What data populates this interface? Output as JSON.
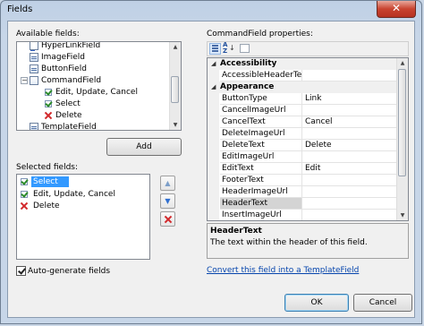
{
  "window": {
    "title": "Fields",
    "close_glyph": "✕"
  },
  "available": {
    "label": "Available fields:",
    "items": [
      {
        "label": "HyperLinkField",
        "icon": "hyperlink-field-icon"
      },
      {
        "label": "ImageField",
        "icon": "image-field-icon"
      },
      {
        "label": "ButtonField",
        "icon": "button-field-icon"
      },
      {
        "label": "CommandField",
        "icon": "command-field-icon",
        "expanded": true
      },
      {
        "label": "Edit, Update, Cancel",
        "icon": "check-icon"
      },
      {
        "label": "Select",
        "icon": "check-icon"
      },
      {
        "label": "Delete",
        "icon": "delete-icon"
      },
      {
        "label": "TemplateField",
        "icon": "template-field-icon"
      }
    ],
    "add_button": "Add"
  },
  "selected": {
    "label": "Selected fields:",
    "items": [
      {
        "label": "Select",
        "icon": "check-icon",
        "selected": true
      },
      {
        "label": "Edit, Update, Cancel",
        "icon": "check-icon"
      },
      {
        "label": "Delete",
        "icon": "delete-icon"
      }
    ]
  },
  "autogen": {
    "label": "Auto-generate fields",
    "checked": true
  },
  "properties": {
    "label": "CommandField properties:",
    "rows": [
      {
        "type": "category",
        "name": "Accessibility"
      },
      {
        "type": "prop",
        "name": "AccessibleHeaderText",
        "value": ""
      },
      {
        "type": "category",
        "name": "Appearance"
      },
      {
        "type": "prop",
        "name": "ButtonType",
        "value": "Link"
      },
      {
        "type": "prop",
        "name": "CancelImageUrl",
        "value": ""
      },
      {
        "type": "prop",
        "name": "CancelText",
        "value": "Cancel"
      },
      {
        "type": "prop",
        "name": "DeleteImageUrl",
        "value": ""
      },
      {
        "type": "prop",
        "name": "DeleteText",
        "value": "Delete"
      },
      {
        "type": "prop",
        "name": "EditImageUrl",
        "value": ""
      },
      {
        "type": "prop",
        "name": "EditText",
        "value": "Edit"
      },
      {
        "type": "prop",
        "name": "FooterText",
        "value": ""
      },
      {
        "type": "prop",
        "name": "HeaderImageUrl",
        "value": ""
      },
      {
        "type": "prop",
        "name": "HeaderText",
        "value": "",
        "highlighted": true
      },
      {
        "type": "prop",
        "name": "InsertImageUrl",
        "value": ""
      }
    ],
    "description_title": "HeaderText",
    "description_text": "The text within the header of this field."
  },
  "convert_link": "Convert this field into a TemplateField",
  "buttons": {
    "ok": "OK",
    "cancel": "Cancel"
  },
  "colors": {
    "selection": "#3399ff",
    "link": "#0645ad"
  }
}
